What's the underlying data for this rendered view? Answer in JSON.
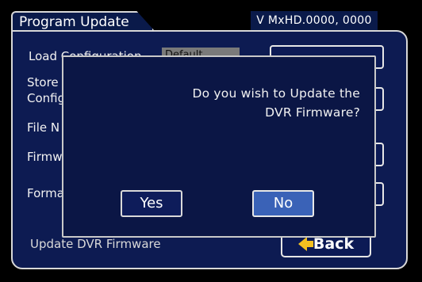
{
  "header": {
    "tab_title": "Program Update",
    "version": "V MxHD.0000, 0000"
  },
  "background": {
    "labels": [
      "Load Configuration",
      "Store",
      "Config",
      "File N",
      "Firmw",
      "Forma",
      "Update DVR Firmware"
    ],
    "field_value": "Default"
  },
  "back_button": {
    "label": "Back",
    "icon": "arrow-left-icon"
  },
  "dialog": {
    "line1": "Do you wish to Update the",
    "line2": "DVR Firmware?",
    "yes_label": "Yes",
    "no_label": "No"
  },
  "colors": {
    "panel": "#0d1b52",
    "dialog": "#0b1645",
    "selected_button": "#3a62b7",
    "arrow": "#f3c020"
  }
}
